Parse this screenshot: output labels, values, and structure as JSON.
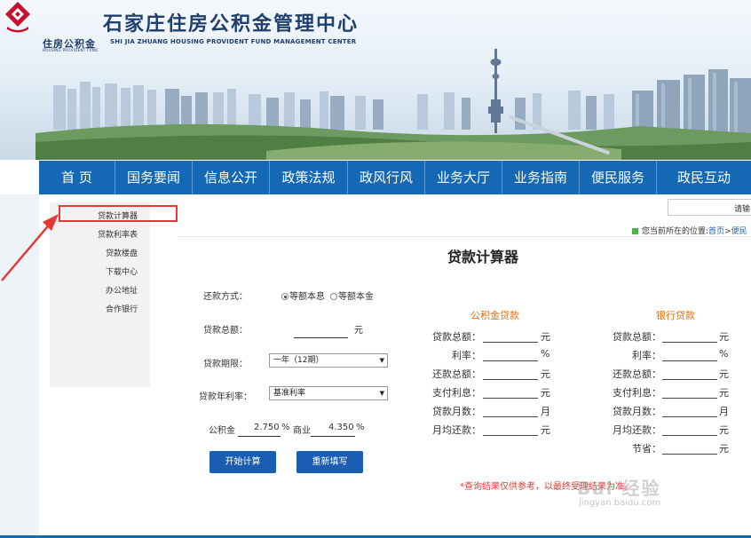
{
  "header": {
    "logo_cn": "住房公积金",
    "logo_en": "HOUSING PROVIDENT FUND",
    "title": "石家庄住房公积金管理中心",
    "subtitle": "SHI JIA ZHUANG HOUSING PROVIDENT FUND MANAGEMENT CENTER"
  },
  "nav": {
    "items": [
      {
        "label": "首  页"
      },
      {
        "label": "国务要闻"
      },
      {
        "label": "信息公开"
      },
      {
        "label": "政策法规"
      },
      {
        "label": "政风行风"
      },
      {
        "label": "业务大厅"
      },
      {
        "label": "业务指南"
      },
      {
        "label": "便民服务"
      },
      {
        "label": "政民互动"
      }
    ]
  },
  "sidebar": {
    "items": [
      {
        "label": "贷款计算器"
      },
      {
        "label": "贷款利率表"
      },
      {
        "label": "贷款楼盘"
      },
      {
        "label": "下载中心"
      },
      {
        "label": "办公地址"
      },
      {
        "label": "合作银行"
      }
    ]
  },
  "search": {
    "placeholder": "请输"
  },
  "breadcrumb": {
    "prefix": "您当前所在的位置:",
    "home": "首页",
    "sep": ">",
    "current": "便民"
  },
  "calculator": {
    "title": "贷款计算器",
    "repay_label": "还款方式：",
    "repay_options": [
      {
        "label": "等额本息",
        "selected": true
      },
      {
        "label": "等额本金",
        "selected": false
      }
    ],
    "total_label": "贷款总额：",
    "total_unit": "元",
    "term_label": "贷款期限：",
    "term_value": "一年（12期）",
    "rate_label": "贷款年利率：",
    "rate_value": "基准利率",
    "fund_rate_label": "公积金",
    "fund_rate_value": "2.750",
    "pct": "%",
    "commercial_label": "商业",
    "commercial_rate_value": "4.350",
    "calc_button": "开始计算",
    "reset_button": "重新填写"
  },
  "results": {
    "fund_title": "公积金贷款",
    "bank_title": "银行贷款",
    "fund_rows": [
      {
        "label": "贷款总额：",
        "unit": "元"
      },
      {
        "label": "利率：",
        "unit": "%"
      },
      {
        "label": "还款总额：",
        "unit": "元"
      },
      {
        "label": "支付利息：",
        "unit": "元"
      },
      {
        "label": "贷款月数：",
        "unit": "月"
      },
      {
        "label": "月均还款：",
        "unit": "元"
      }
    ],
    "bank_rows": [
      {
        "label": "贷款总额：",
        "unit": "元"
      },
      {
        "label": "利率：",
        "unit": "%"
      },
      {
        "label": "还款总额：",
        "unit": "元"
      },
      {
        "label": "支付利息：",
        "unit": "元"
      },
      {
        "label": "贷款月数：",
        "unit": "月"
      },
      {
        "label": "月均还款：",
        "unit": "元"
      },
      {
        "label": "节省：",
        "unit": "元"
      }
    ]
  },
  "disclaimer": "*查询结果仅供参考，以最终受理结果为准。",
  "watermark": {
    "text": "Bai 经验",
    "url": "jingyan.baidu.com"
  },
  "colors": {
    "nav": "#1468b4",
    "button": "#1b5db2",
    "highlight": "#e53935",
    "result_head": "#ef6c00"
  }
}
